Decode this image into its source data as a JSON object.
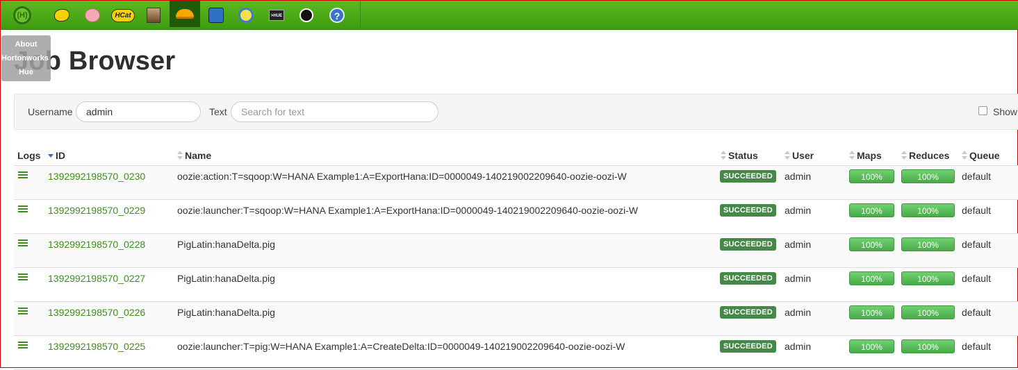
{
  "topbar": {
    "icons": [
      {
        "name": "hue-home-icon"
      },
      {
        "name": "beeswax-icon"
      },
      {
        "name": "pig-icon"
      },
      {
        "name": "hcatalog-icon",
        "label": "HCat"
      },
      {
        "name": "file-browser-icon"
      },
      {
        "name": "job-browser-icon"
      },
      {
        "name": "oozie-editor-icon"
      },
      {
        "name": "job-designer-icon"
      },
      {
        "name": "shell-icon",
        "label": ">HUE"
      },
      {
        "name": "user-admin-icon"
      },
      {
        "name": "help-icon",
        "label": "?"
      }
    ]
  },
  "about_popup": {
    "line1": "About",
    "line2": "Hortonworks",
    "line3": "Hue"
  },
  "page_title": "Job Browser",
  "filters": {
    "username_label": "Username",
    "username_value": "admin",
    "text_label": "Text",
    "text_placeholder": "Search for text",
    "show_label": "Show"
  },
  "table": {
    "headers": {
      "logs": "Logs",
      "id": "ID",
      "name": "Name",
      "status": "Status",
      "user": "User",
      "maps": "Maps",
      "reduces": "Reduces",
      "queue": "Queue"
    },
    "rows": [
      {
        "id": "1392992198570_0230",
        "name": "oozie:action:T=sqoop:W=HANA Example1:A=ExportHana:ID=0000049-140219002209640-oozie-oozi-W",
        "status": "SUCCEEDED",
        "user": "admin",
        "maps": "100%",
        "reduces": "100%",
        "queue": "default"
      },
      {
        "id": "1392992198570_0229",
        "name": "oozie:launcher:T=sqoop:W=HANA Example1:A=ExportHana:ID=0000049-140219002209640-oozie-oozi-W",
        "status": "SUCCEEDED",
        "user": "admin",
        "maps": "100%",
        "reduces": "100%",
        "queue": "default"
      },
      {
        "id": "1392992198570_0228",
        "name": "PigLatin:hanaDelta.pig",
        "status": "SUCCEEDED",
        "user": "admin",
        "maps": "100%",
        "reduces": "100%",
        "queue": "default"
      },
      {
        "id": "1392992198570_0227",
        "name": "PigLatin:hanaDelta.pig",
        "status": "SUCCEEDED",
        "user": "admin",
        "maps": "100%",
        "reduces": "100%",
        "queue": "default"
      },
      {
        "id": "1392992198570_0226",
        "name": "PigLatin:hanaDelta.pig",
        "status": "SUCCEEDED",
        "user": "admin",
        "maps": "100%",
        "reduces": "100%",
        "queue": "default"
      },
      {
        "id": "1392992198570_0225",
        "name": "oozie:launcher:T=pig:W=HANA Example1:A=CreateDelta:ID=0000049-140219002209640-oozie-oozi-W",
        "status": "SUCCEEDED",
        "user": "admin",
        "maps": "100%",
        "reduces": "100%",
        "queue": "default"
      }
    ]
  },
  "colors": {
    "topbar": "#4caf19",
    "link_green": "#3c8f1a",
    "status_badge": "#468847",
    "progress": "#5cc05c"
  }
}
